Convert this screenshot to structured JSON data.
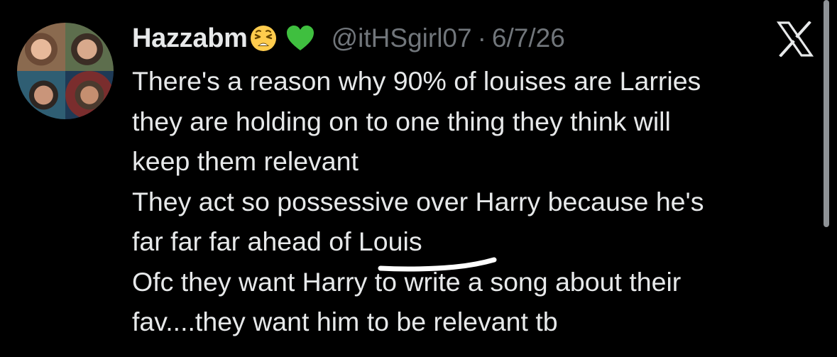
{
  "tweet": {
    "display_name": "Hazzabm",
    "emojis": [
      "tired-face-emoji",
      "green-heart-emoji"
    ],
    "handle": "@itHSgirl07",
    "separator": "·",
    "date": "6/7/26",
    "lines": [
      "There's a reason why 90% of louises are Larries",
      "they are holding on to one thing they think will",
      "keep them relevant",
      "They act so possessive over Harry because he's",
      "far far far ahead of Louis",
      "Ofc they want Harry to write a song about their",
      "fav....they want him to be relevant tb"
    ]
  },
  "colors": {
    "background": "#000000",
    "text": "#e7e9ea",
    "muted": "#71767b"
  },
  "icons": {
    "brand": "x-logo-icon"
  }
}
